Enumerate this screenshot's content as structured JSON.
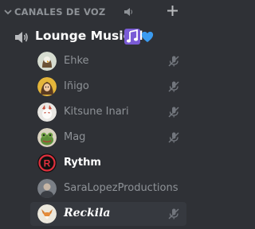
{
  "header": {
    "title": "CANALES DE VOZ",
    "icons": [
      "chevron-down-icon",
      "speaker-icon",
      "plus-icon"
    ]
  },
  "channel": {
    "name": "Lounge Musical",
    "icons": [
      "volume-icon",
      "music-note-emoji-icon",
      "blue-heart-emoji-icon"
    ]
  },
  "users": [
    {
      "name": "Ehke",
      "avatar": "eagle-avatar",
      "muted": true,
      "style": "normal"
    },
    {
      "name": "Iñigo",
      "avatar": "portrait-avatar",
      "muted": true,
      "style": "normal"
    },
    {
      "name": "Kitsune Inari",
      "avatar": "kitsune-avatar",
      "muted": true,
      "style": "normal"
    },
    {
      "name": "Mag",
      "avatar": "frog-avatar",
      "muted": true,
      "style": "normal"
    },
    {
      "name": "Rythm",
      "avatar": "rythm-bot-avatar",
      "muted": false,
      "style": "bold"
    },
    {
      "name": "SaraLopezProductions",
      "avatar": "photo-avatar",
      "muted": false,
      "style": "normal"
    },
    {
      "name": "Reckila",
      "avatar": "fox-avatar",
      "muted": true,
      "style": "script"
    }
  ],
  "colors": {
    "background": "#2f3136",
    "hover": "#36393f",
    "muted_text": "#8e9297",
    "accent_red": "#e0303d"
  }
}
